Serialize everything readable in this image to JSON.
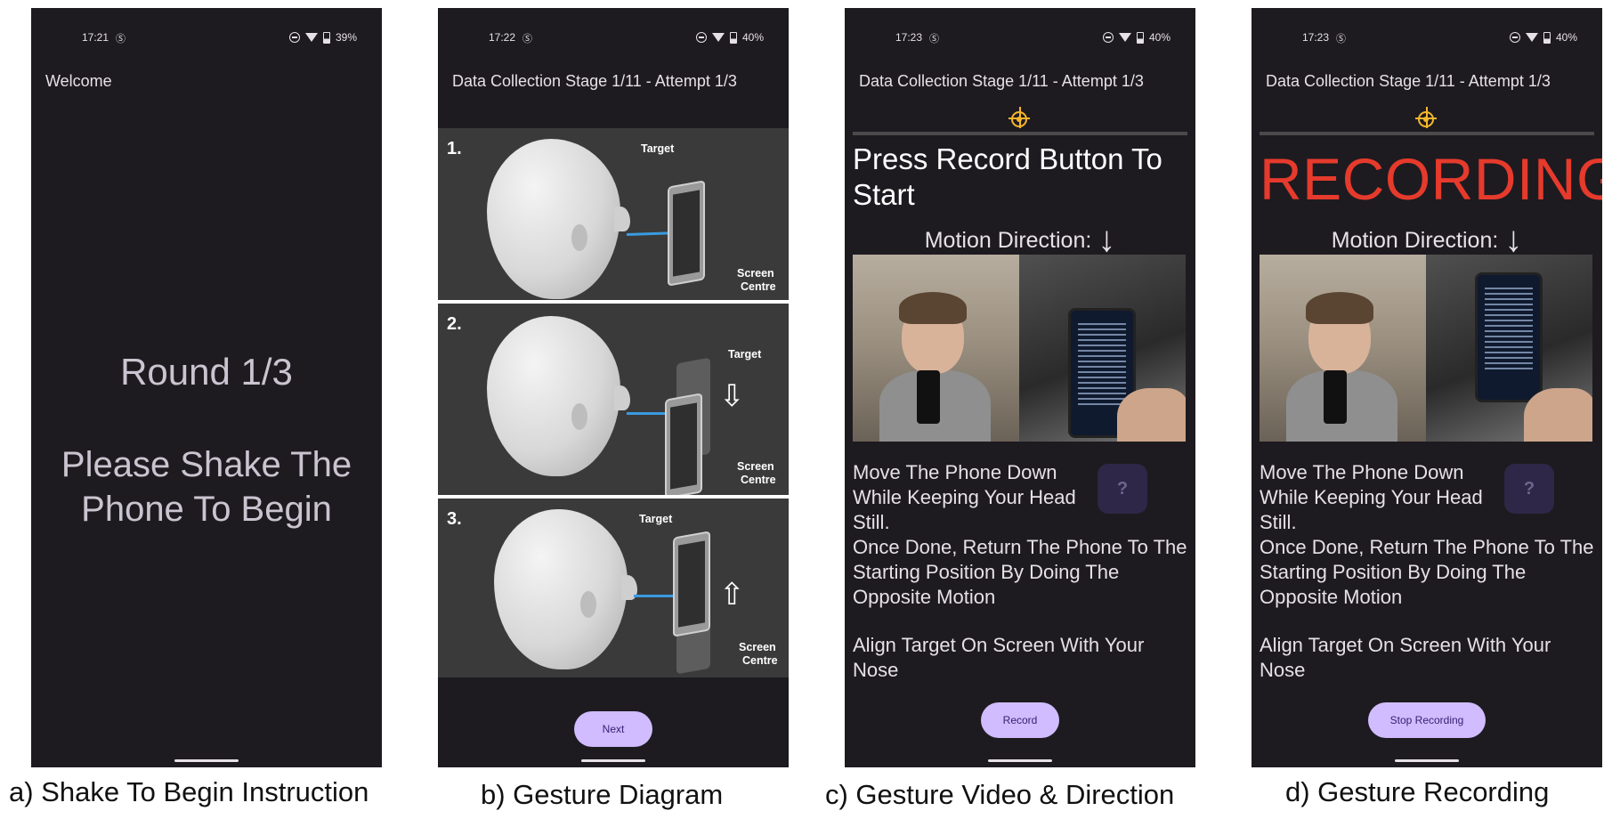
{
  "screens": [
    {
      "time": "17:21",
      "battery": "39%",
      "title": "Welcome",
      "round": "Round 1/3",
      "shake": "Please Shake The Phone To Begin",
      "caption": "a) Shake To Begin Instruction"
    },
    {
      "time": "17:22",
      "battery": "40%",
      "title": "Data Collection Stage 1/11 - Attempt 1/3",
      "diagram": {
        "panels": [
          {
            "num": "1.",
            "target": "Target",
            "screen": "Screen",
            "centre": "Centre"
          },
          {
            "num": "2.",
            "target": "Target",
            "screen": "Screen",
            "centre": "Centre"
          },
          {
            "num": "3.",
            "target": "Target",
            "screen": "Screen",
            "centre": "Centre"
          }
        ]
      },
      "button": "Next",
      "caption": "b) Gesture Diagram"
    },
    {
      "time": "17:23",
      "battery": "40%",
      "title": "Data Collection Stage 1/11 - Attempt 1/3",
      "heading": "Press Record Button To Start",
      "motion": "Motion Direction:",
      "instruction1": "Move The Phone Down While Keeping Your Head Still.",
      "instruction2": "Once Done, Return The Phone To The Starting Position By Doing The Opposite Motion",
      "instruction3": "Align Target On Screen With Your Nose",
      "help": "?",
      "button": "Record",
      "caption": "c) Gesture Video & Direction"
    },
    {
      "time": "17:23",
      "battery": "40%",
      "title": "Data Collection Stage 1/11 - Attempt 1/3",
      "heading": "RECORDING",
      "motion": "Motion Direction:",
      "instruction1": "Move The Phone Down While Keeping Your Head Still.",
      "instruction2": "Once Done, Return The Phone To The Starting Position By Doing The Opposite Motion",
      "instruction3": "Align Target On Screen With Your Nose",
      "help": "?",
      "button": "Stop Recording",
      "caption": "d) Gesture Recording"
    }
  ],
  "colors": {
    "background": "#1d1b20",
    "button": "#d0bcff",
    "recording": "#e53a2c",
    "target": "#f6b62b",
    "help": "#2e2747"
  },
  "icons": {
    "motion_arrow": "down-arrow-icon",
    "target": "crosshair-target-icon",
    "status": [
      "sim-icon",
      "do-not-disturb-icon",
      "wifi-icon",
      "battery-icon"
    ]
  }
}
